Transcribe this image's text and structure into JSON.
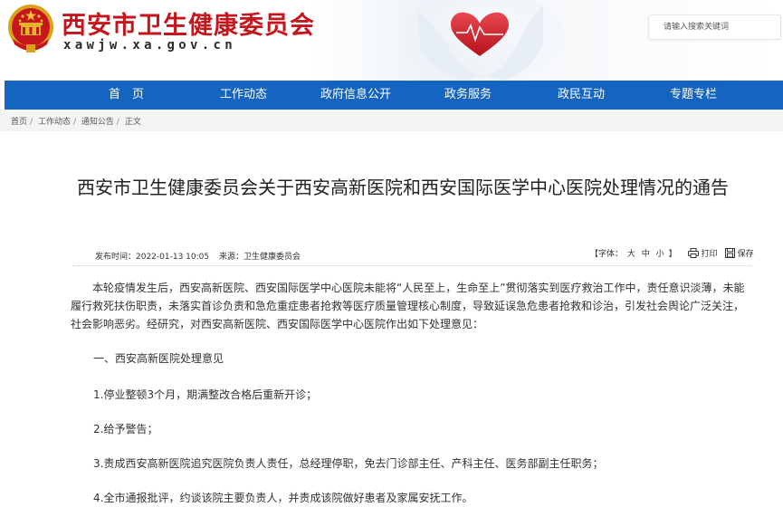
{
  "header": {
    "site_title": "西安市卫生健康委员会",
    "site_domain": "xawjw.xa.gov.cn",
    "search_placeholder": "请输入搜索关键词"
  },
  "nav": {
    "items": [
      {
        "label": "首　页"
      },
      {
        "label": "工作动态"
      },
      {
        "label": "政府信息公开"
      },
      {
        "label": "政务服务"
      },
      {
        "label": "政民互动"
      },
      {
        "label": "专题专栏"
      }
    ]
  },
  "breadcrumb": [
    "首页",
    "工作动态",
    "通知公告",
    "正文"
  ],
  "article": {
    "title": "西安市卫生健康委员会关于西安高新医院和西安国际医学中心医院处理情况的通告",
    "publish_time": "发布时间：2022-01-13 10:05",
    "source": "来源：卫生健康委员会",
    "font_size_label": "【字体：",
    "font_sizes": [
      "大",
      "中",
      "小"
    ],
    "font_size_close": "】",
    "print_label": "打印",
    "save_label": "保存",
    "paragraphs": [
      "本轮疫情发生后，西安高新医院、西安国际医学中心医院未能将“人民至上，生命至上”贯彻落实到医疗救治工作中，责任意识淡薄，未能履行救死扶伤职责，未落实首诊负责和急危重症患者抢救等医疗质量管理核心制度，导致延误急危患者抢救和诊治，引发社会舆论广泛关注，社会影响恶劣。经研究，对西安高新医院、西安国际医学中心医院作出如下处理意见：",
      "一、西安高新医院处理意见",
      "1.停业整顿3个月，期满整改合格后重新开诊；",
      "2.给予警告；",
      "3.责成西安高新医院追究医院负责人责任，总经理停职，免去门诊部主任、产科主任、医务部副主任职务；",
      "4.全市通报批评，约谈该院主要负责人，并责成该院做好患者及家属安抚工作。"
    ]
  },
  "colors": {
    "brand_red": "#c6161d",
    "nav_blue": "#1565c0"
  }
}
